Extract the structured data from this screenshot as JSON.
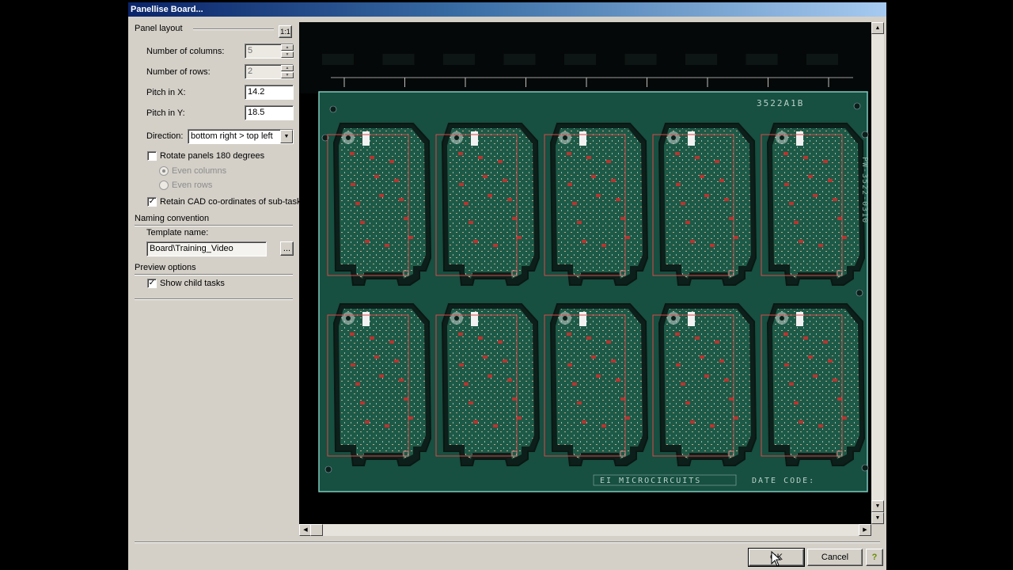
{
  "dialog": {
    "title": "Panellise Board..."
  },
  "panel_layout": {
    "section_label": "Panel layout",
    "scale_button": "1:1",
    "columns_label": "Number of columns:",
    "columns_value": "5",
    "rows_label": "Number of rows:",
    "rows_value": "2",
    "pitch_x_label": "Pitch in X:",
    "pitch_x_value": "14.2",
    "pitch_y_label": "Pitch in Y:",
    "pitch_y_value": "18.5",
    "direction_label": "Direction:",
    "direction_value": "bottom right > top left",
    "rotate_label": "Rotate panels 180 degrees",
    "rotate_checked": false,
    "even_columns_label": "Even columns",
    "even_rows_label": "Even rows",
    "retain_label": "Retain CAD co-ordinates of sub-tasks",
    "retain_checked": true
  },
  "naming": {
    "section_label": "Naming convention",
    "template_label": "Template name:",
    "template_value": "Board\\Training_Video",
    "browse_label": "..."
  },
  "preview_options": {
    "section_label": "Preview options",
    "show_child_label": "Show child tasks",
    "show_child_checked": true
  },
  "board": {
    "part_number": "3522A1B",
    "side_code": "PW-3522-0310",
    "maker_text": "EI MICROCIRCUITS",
    "date_code_text": "DATE CODE:",
    "board_color": "#174f40",
    "outline_color": "#7fc9bd",
    "child_outline_color": "#d9484a",
    "columns": 5,
    "rows": 2
  },
  "buttons": {
    "ok": "OK",
    "cancel": "Cancel",
    "help": "?"
  }
}
